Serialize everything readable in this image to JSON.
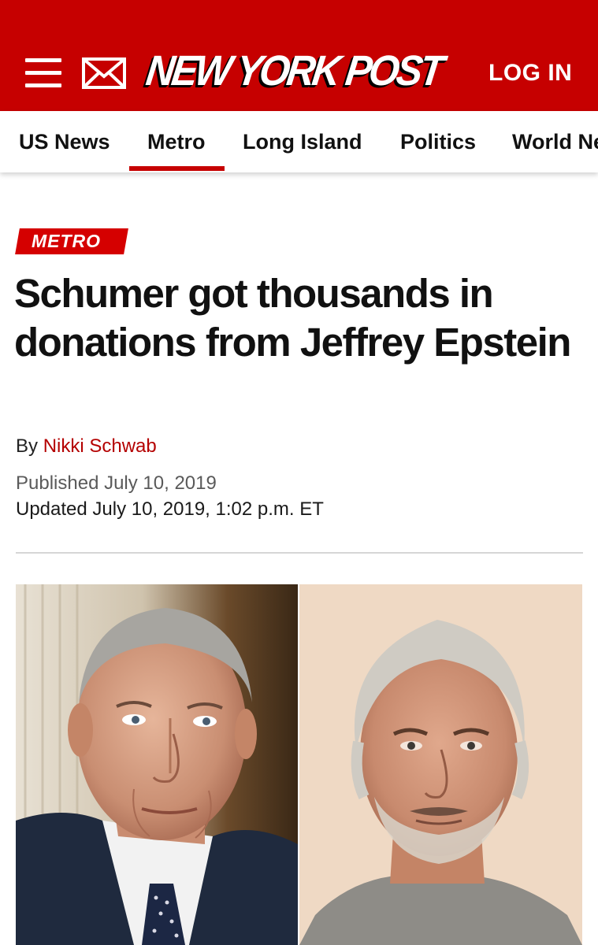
{
  "header": {
    "logo_text": "NEW YORK POST",
    "login_label": "LOG IN",
    "menu_icon": "hamburger-menu-icon",
    "mail_icon": "mail-icon",
    "brand_color": "#c60000"
  },
  "nav": {
    "items": [
      {
        "label": "US News"
      },
      {
        "label": "Metro",
        "active": true
      },
      {
        "label": "Long Island"
      },
      {
        "label": "Politics"
      },
      {
        "label": "World Ne"
      }
    ]
  },
  "article": {
    "section_badge": "METRO",
    "headline": "Schumer got thousands in donations from Jeffrey Epstein",
    "byline_prefix": "By",
    "author": "Nikki Schwab",
    "published": "Published July 10, 2019",
    "updated": "Updated July 10, 2019, 1:02 p.m. ET",
    "photos": [
      "photo-left-portrait",
      "photo-right-mugshot"
    ]
  }
}
